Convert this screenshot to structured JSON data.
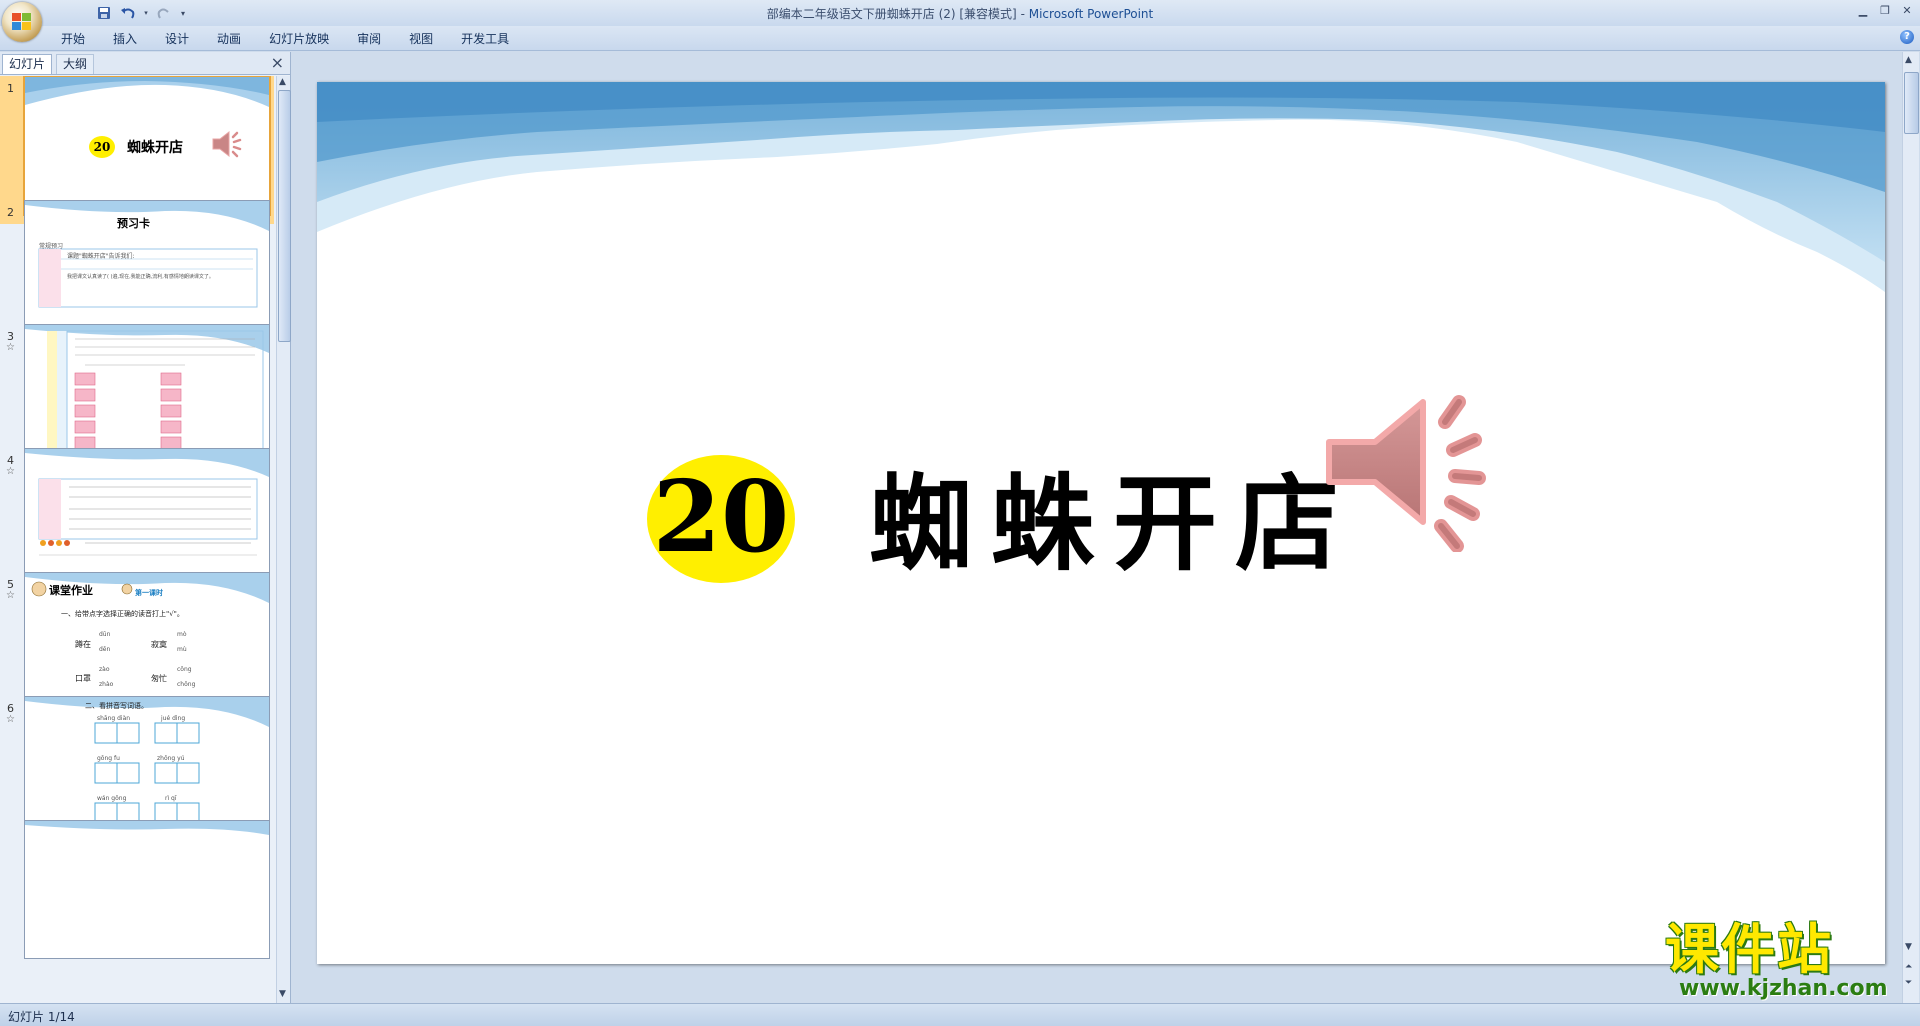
{
  "window": {
    "title": "部编本二年级语文下册蜘蛛开店 (2) [兼容模式]",
    "app_name": "Microsoft PowerPoint",
    "controls": [
      "minimize",
      "restore",
      "close"
    ]
  },
  "quick_access": [
    "save-icon",
    "undo-icon",
    "redo-icon",
    "customize-icon"
  ],
  "ribbon": {
    "tabs": [
      "开始",
      "插入",
      "设计",
      "动画",
      "幻灯片放映",
      "审阅",
      "视图",
      "开发工具"
    ]
  },
  "left_pane": {
    "tabs": [
      "幻灯片",
      "大纲"
    ],
    "close": "×",
    "slides": [
      {
        "num": "1",
        "selected": true,
        "title_number": "20",
        "title": "蜘蛛开店"
      },
      {
        "num": "2",
        "title": "预习卡",
        "lines": [
          "常规预习",
          "课题\"蜘蛛开店\"告诉我们:",
          "我把课文认真读了(      )遍,现在,我能正确,流利,有感情地朗读课文了。"
        ]
      },
      {
        "num": "3",
        "star": "☆"
      },
      {
        "num": "4",
        "star": "☆"
      },
      {
        "num": "5",
        "star": "☆",
        "title": "课堂作业",
        "subtitle": "第一课时",
        "question": "一、给带点字选择正确的读音打上\"√\"。",
        "items": [
          "蹲在",
          "寂寞",
          "口罩",
          "匆忙"
        ],
        "pinyin": [
          "dūn",
          "dēn",
          "mò",
          "mù",
          "zào",
          "zhào",
          "cōng",
          "chōng"
        ]
      },
      {
        "num": "6",
        "star": "☆",
        "question": "二、看拼音写词语。",
        "pinyin": [
          "shāng diàn",
          "jué dìng",
          "gōng fu",
          "zhōng yú",
          "wán gōng",
          "rì qī"
        ]
      }
    ]
  },
  "main_slide": {
    "number": "20",
    "title": "蜘蛛开店",
    "has_audio_icon": true
  },
  "status_bar": {
    "slide_indicator": "幻灯片 1/14"
  },
  "watermark": {
    "text": "课件站",
    "url": "www.kjzhan.com"
  },
  "colors": {
    "badge_yellow": "#ffef00",
    "sky_blue": "#7fb8de",
    "selection": "#ffd88c"
  }
}
